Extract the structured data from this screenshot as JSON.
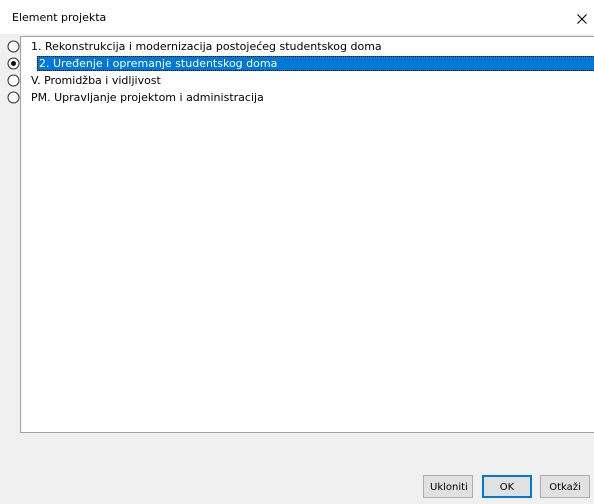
{
  "window": {
    "title": "Element projekta"
  },
  "list": {
    "items": [
      {
        "label": "1. Rekonstrukcija i modernizacija postojećeg studentskog doma",
        "selected": false
      },
      {
        "label": "2. Uređenje i opremanje studentskog doma",
        "selected": true
      },
      {
        "label": "V. Promidžba i vidljivost",
        "selected": false
      },
      {
        "label": "PM. Upravljanje projektom i administracija",
        "selected": false
      }
    ]
  },
  "buttons": {
    "remove_label": "Ukloniti",
    "ok_label": "OK",
    "cancel_label": "Otkaži"
  },
  "colors": {
    "selection": "#0078d7",
    "dialog_bg": "#f0f0f0"
  }
}
